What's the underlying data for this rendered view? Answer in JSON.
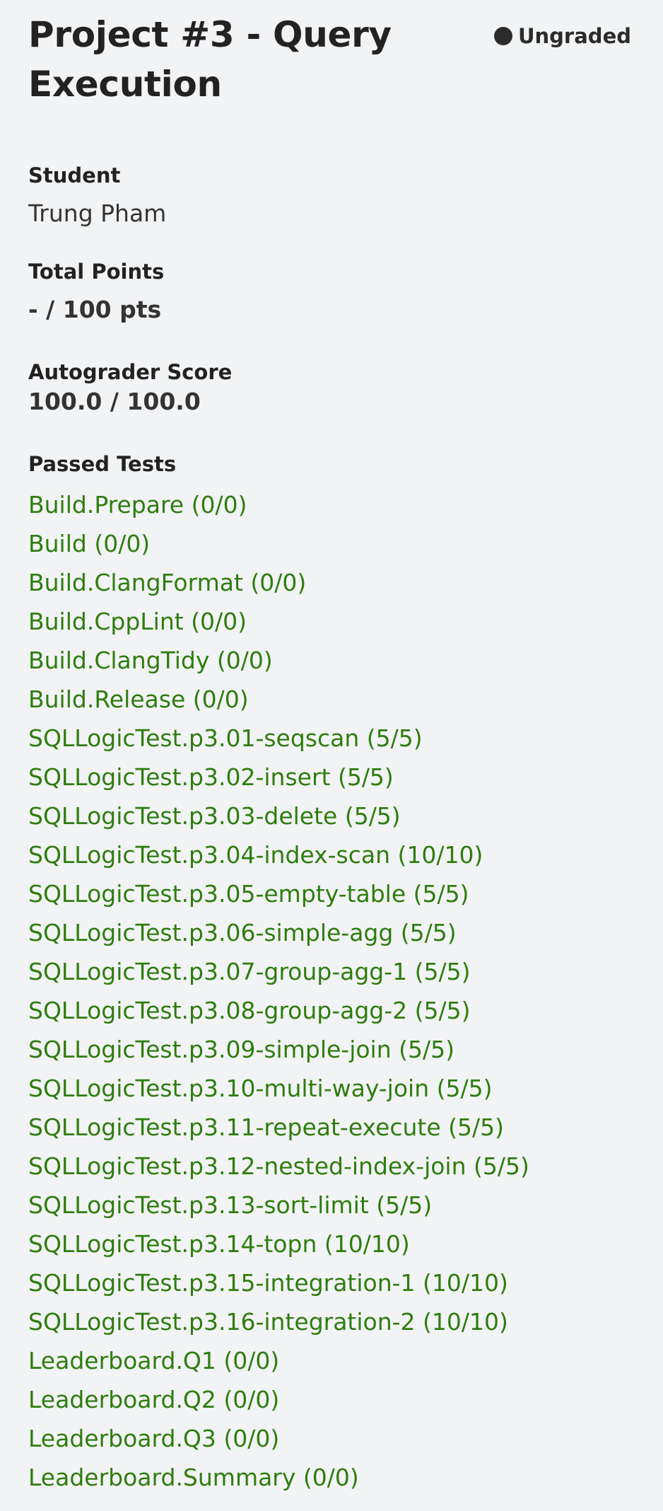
{
  "header": {
    "title": "Project #3 - Query Execution",
    "status": "Ungraded"
  },
  "student": {
    "label": "Student",
    "name": "Trung Pham"
  },
  "total_points": {
    "label": "Total Points",
    "value": "- / 100 pts"
  },
  "autograder": {
    "label": "Autograder Score",
    "value": "100.0 / 100.0"
  },
  "passed_tests": {
    "label": "Passed Tests",
    "items": [
      "Build.Prepare (0/0)",
      "Build (0/0)",
      "Build.ClangFormat (0/0)",
      "Build.CppLint (0/0)",
      "Build.ClangTidy (0/0)",
      "Build.Release (0/0)",
      "SQLLogicTest.p3.01-seqscan (5/5)",
      "SQLLogicTest.p3.02-insert (5/5)",
      "SQLLogicTest.p3.03-delete (5/5)",
      "SQLLogicTest.p3.04-index-scan (10/10)",
      "SQLLogicTest.p3.05-empty-table (5/5)",
      "SQLLogicTest.p3.06-simple-agg (5/5)",
      "SQLLogicTest.p3.07-group-agg-1 (5/5)",
      "SQLLogicTest.p3.08-group-agg-2 (5/5)",
      "SQLLogicTest.p3.09-simple-join (5/5)",
      "SQLLogicTest.p3.10-multi-way-join (5/5)",
      "SQLLogicTest.p3.11-repeat-execute (5/5)",
      "SQLLogicTest.p3.12-nested-index-join (5/5)",
      "SQLLogicTest.p3.13-sort-limit (5/5)",
      "SQLLogicTest.p3.14-topn (10/10)",
      "SQLLogicTest.p3.15-integration-1 (10/10)",
      "SQLLogicTest.p3.16-integration-2 (10/10)",
      "Leaderboard.Q1 (0/0)",
      "Leaderboard.Q2 (0/0)",
      "Leaderboard.Q3 (0/0)",
      "Leaderboard.Summary (0/0)"
    ]
  },
  "colors": {
    "background": "#f2f3f5",
    "text": "#2b2b2b",
    "passed": "#2e7d0e"
  }
}
